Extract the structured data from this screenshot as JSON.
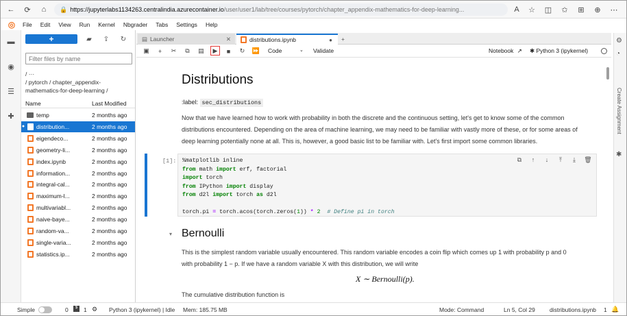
{
  "browser": {
    "url_host": "https://jupyterlabs1134263.centralindia.azurecontainer.io",
    "url_path": "/user/user1/lab/tree/courses/pytorch/chapter_appendix-mathematics-for-deep-learning..."
  },
  "menu": [
    "File",
    "Edit",
    "View",
    "Run",
    "Kernel",
    "Nbgrader",
    "Tabs",
    "Settings",
    "Help"
  ],
  "filebrowser": {
    "new_label": "+",
    "filter_placeholder": "Filter files by name",
    "crumb_line1": "/ ···",
    "crumb_line2": "/ pytorch / chapter_appendix-",
    "crumb_line3": "mathematics-for-deep-learning /",
    "col_name": "Name",
    "col_modified": "Last Modified",
    "files": [
      {
        "name": "temp",
        "modified": "2 months ago",
        "type": "folder"
      },
      {
        "name": "distribution...",
        "modified": "2 months ago",
        "type": "notebook"
      },
      {
        "name": "eigendeco...",
        "modified": "2 months ago",
        "type": "notebook"
      },
      {
        "name": "geometry-li...",
        "modified": "2 months ago",
        "type": "notebook"
      },
      {
        "name": "index.ipynb",
        "modified": "2 months ago",
        "type": "notebook"
      },
      {
        "name": "information...",
        "modified": "2 months ago",
        "type": "notebook"
      },
      {
        "name": "integral-cal...",
        "modified": "2 months ago",
        "type": "notebook"
      },
      {
        "name": "maximum-l...",
        "modified": "2 months ago",
        "type": "notebook"
      },
      {
        "name": "multivariabl...",
        "modified": "2 months ago",
        "type": "notebook"
      },
      {
        "name": "naive-baye...",
        "modified": "2 months ago",
        "type": "notebook"
      },
      {
        "name": "random-va...",
        "modified": "2 months ago",
        "type": "notebook"
      },
      {
        "name": "single-varia...",
        "modified": "2 months ago",
        "type": "notebook"
      },
      {
        "name": "statistics.ip...",
        "modified": "2 months ago",
        "type": "notebook"
      }
    ]
  },
  "tabs": {
    "launcher": "Launcher",
    "notebook": "distributions.ipynb"
  },
  "toolbar": {
    "cell_type": "Code",
    "validate": "Validate",
    "notebook_label": "Notebook",
    "kernel": "Python 3 (ipykernel)"
  },
  "notebook": {
    "title": "Distributions",
    "label_prefix": ":label:",
    "label_code": "sec_distributions",
    "intro": "Now that we have learned how to work with probability in both the discrete and the continuous setting, let's get to know some of the common distributions encountered. Depending on the area of machine learning, we may need to be familiar with vastly more of these, or for some areas of deep learning potentially none at all. This is, however, a good basic list to be familiar with. Let's first import some common libraries.",
    "prompt": "[1]:",
    "bernoulli_title": "Bernoulli",
    "bernoulli_p1": "This is the simplest random variable usually encountered. This random variable encodes a coin flip which comes up 1 with probability p and 0",
    "bernoulli_p2": "with probability 1 − p. If we have a random variable X with this distribution, we will write",
    "bernoulli_math": "X ∼ Bernoulli(p).",
    "cdf_text": "The cumulative distribution function is"
  },
  "sidebar_right": {
    "create_assignment": "Create Assignment"
  },
  "statusbar": {
    "simple": "Simple",
    "count1": "0",
    "count2": "1",
    "kernel_status": "Python 3 (ipykernel) | Idle",
    "mem": "Mem: 185.75 MB",
    "mode": "Mode: Command",
    "position": "Ln 5, Col 29",
    "file": "distributions.ipynb",
    "count3": "1"
  },
  "colors": {
    "accent": "#1976d2",
    "jupyter_orange": "#f37726",
    "run_highlight": "#e53935"
  }
}
